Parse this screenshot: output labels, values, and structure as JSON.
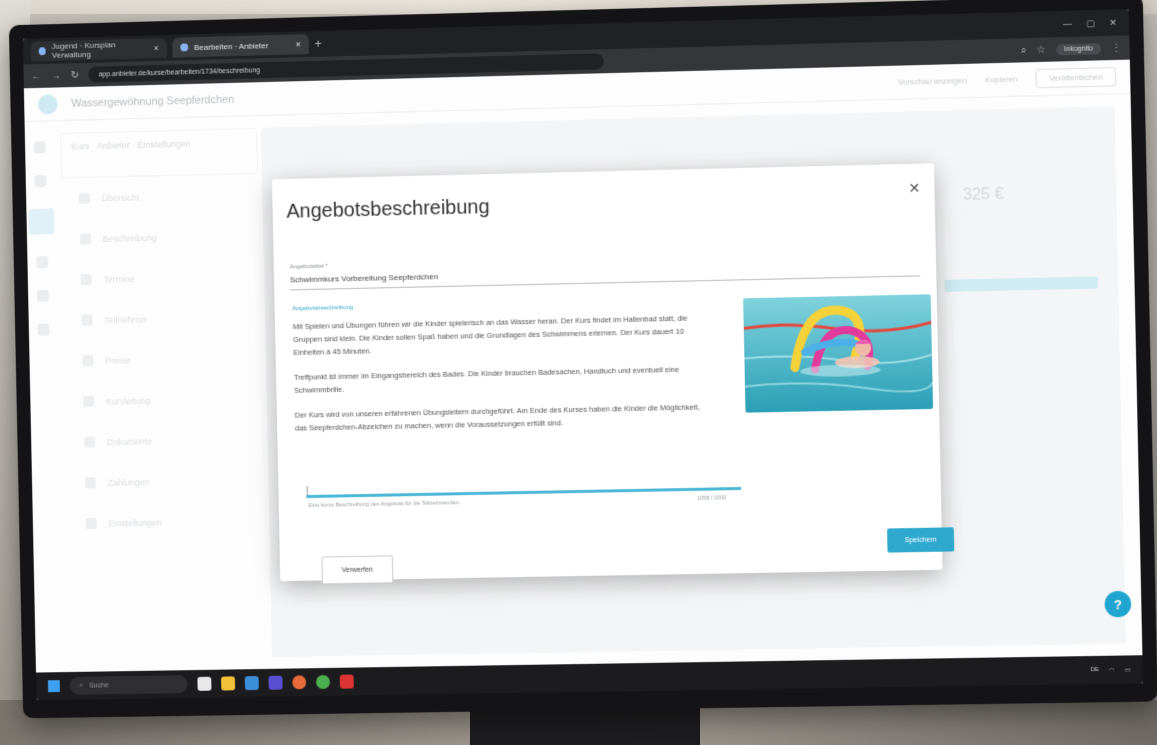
{
  "browser": {
    "tabs": [
      {
        "label": "Jugend · Kursplan Verwaltung",
        "active": false
      },
      {
        "label": "Bearbeiten · Anbieter",
        "active": true
      }
    ],
    "url": "app.anbieter.de/kurse/bearbeiten/1734/beschreibung",
    "profile_label": "Inkognito"
  },
  "app": {
    "title": "Wassergewöhnung Seepferdchen",
    "actions": [
      "Vorschau anzeigen",
      "Kopieren",
      "Veröffentlichen"
    ],
    "sidebar_header": "Kurs · Anbieter · Einstellungen",
    "sidebar_items": [
      "Übersicht",
      "Beschreibung",
      "Termine",
      "Teilnehmer",
      "Preise",
      "Kursleitung",
      "Dokumente",
      "Zahlungen",
      "Einstellungen"
    ],
    "main_price": "325 €"
  },
  "modal": {
    "title": "Angebotsbeschreibung",
    "close_label": "✕",
    "field_label": "Angebotstitel *",
    "field_value": "Schwimmkurs Vorbereitung Seepferdchen",
    "desc_label": "Angebotsbeschreibung",
    "paragraphs": [
      "Mit Spielen und Übungen führen wir die Kinder spielerisch an das Wasser heran. Der Kurs findet im Hallenbad statt, die Gruppen sind klein. Die Kinder sollen Spaß haben und die Grundlagen des Schwimmens erlernen. Der Kurs dauert 10 Einheiten à 45 Minuten.",
      "Treffpunkt ist immer im Eingangsbereich des Bades. Die Kinder brauchen Badesachen, Handtuch und eventuell eine Schwimmbrille.",
      "Der Kurs wird von unseren erfahrenen Übungsleitern durchgeführt. Am Ende des Kurses haben die Kinder die Möglichkeit, das Seepferdchen-Abzeichen zu machen, wenn die Voraussetzungen erfüllt sind."
    ],
    "helper_text": "Eine kurze Beschreibung des Angebots für die Teilnehmenden.",
    "counter": "1058 / 2000",
    "discard_label": "Verwerfen",
    "save_label": "Speichern",
    "accent_color": "#2fa8cf"
  },
  "help_label": "?",
  "taskbar": {
    "search_placeholder": "Suche",
    "tray_text": "DE"
  }
}
